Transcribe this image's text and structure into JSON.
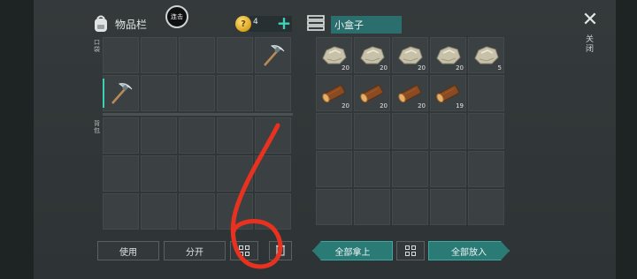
{
  "inventory": {
    "title": "物品栏",
    "link_button_label": "连击",
    "coins": "4",
    "add_icon": "plus-icon",
    "pocket_label": "口袋",
    "backpack_label": "背包",
    "pocket_slots": [
      {
        "item": "",
        "qty": ""
      },
      {
        "item": "",
        "qty": ""
      },
      {
        "item": "",
        "qty": ""
      },
      {
        "item": "",
        "qty": ""
      },
      {
        "item": "pickaxe",
        "qty": ""
      },
      {
        "item": "pickaxe",
        "qty": "",
        "selected": true
      },
      {
        "item": "",
        "qty": ""
      },
      {
        "item": "",
        "qty": ""
      },
      {
        "item": "",
        "qty": ""
      },
      {
        "item": "",
        "qty": ""
      }
    ]
  },
  "box": {
    "title": "小盒子",
    "icon": "books-icon",
    "slots": [
      {
        "item": "stone",
        "qty": "20"
      },
      {
        "item": "stone",
        "qty": "20"
      },
      {
        "item": "stone",
        "qty": "20"
      },
      {
        "item": "stone",
        "qty": "20"
      },
      {
        "item": "stone",
        "qty": "5"
      },
      {
        "item": "log",
        "qty": "20"
      },
      {
        "item": "log",
        "qty": "20"
      },
      {
        "item": "log",
        "qty": "20"
      },
      {
        "item": "log",
        "qty": "19"
      },
      {
        "item": "",
        "qty": ""
      }
    ]
  },
  "close": {
    "icon": "close-icon",
    "label": "关闭"
  },
  "actions": {
    "use": "使用",
    "split": "分开",
    "take_all": "全部拿上",
    "put_all": "全部放入"
  },
  "colors": {
    "accent": "#3ed0b6",
    "teal_button": "#2a7b76",
    "overlay_stroke": "#e8321f"
  },
  "annotation": {
    "text": "6"
  }
}
